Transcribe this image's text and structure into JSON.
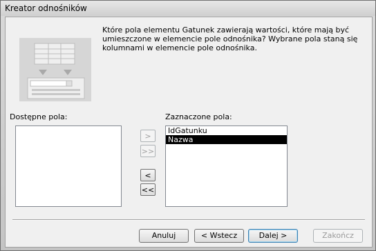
{
  "window": {
    "title": "Kreator odnośników"
  },
  "instruction": "Które pola elementu Gatunek zawierają wartości, które mają być umieszczone w elemencie pole odnośnika? Wybrane pola staną się kolumnami w elemencie pole odnośnika.",
  "available_fields": {
    "label": "Dostępne pola:",
    "items": []
  },
  "selected_fields": {
    "label": "Zaznaczone pola:",
    "items": [
      "IdGatunku",
      "Nazwa"
    ],
    "selected_index": 1
  },
  "move_buttons": {
    "add_one": ">",
    "add_all": ">>",
    "remove_one": "<",
    "remove_all": "<<"
  },
  "buttons": {
    "cancel": "Anuluj",
    "back": "< Wstecz",
    "next": "Dalej >",
    "finish": "Zakończ"
  },
  "colors": {
    "selection": "#000000",
    "window_bg": "#f0f0f0",
    "disabled_text": "#a0a0a0"
  }
}
